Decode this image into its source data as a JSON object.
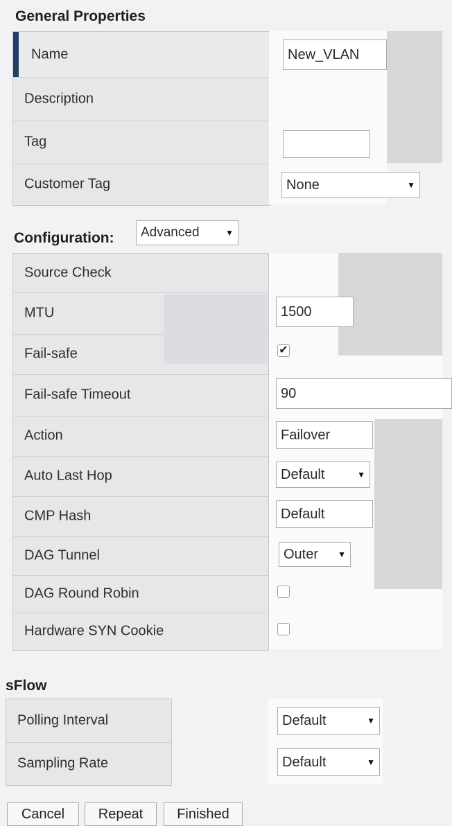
{
  "general": {
    "title": "General Properties",
    "rows": [
      {
        "label": "Name"
      },
      {
        "label": "Description"
      },
      {
        "label": "Tag"
      },
      {
        "label": "Customer Tag"
      }
    ],
    "name_value": "New_VLAN",
    "tag_value": "",
    "customer_tag_value": "None"
  },
  "configuration": {
    "title": "Configuration:",
    "mode_value": "Advanced",
    "rows": [
      {
        "label": "Source Check"
      },
      {
        "label": "MTU"
      },
      {
        "label": "Fail-safe"
      },
      {
        "label": "Fail-safe Timeout"
      },
      {
        "label": "Action"
      },
      {
        "label": "Auto Last Hop"
      },
      {
        "label": "CMP Hash"
      },
      {
        "label": "DAG Tunnel"
      },
      {
        "label": "DAG Round Robin"
      },
      {
        "label": "Hardware SYN Cookie"
      }
    ],
    "mtu_value": "1500",
    "failsafe_checked": true,
    "failsafe_timeout_value": "90",
    "action_value": "Failover",
    "auto_last_hop_value": "Default",
    "cmp_hash_value": "Default",
    "dag_tunnel_value": "Outer",
    "dag_round_robin_checked": false,
    "hardware_syn_cookie_checked": false
  },
  "sflow": {
    "title": "sFlow",
    "rows": [
      {
        "label": "Polling Interval"
      },
      {
        "label": "Sampling Rate"
      }
    ],
    "polling_interval_value": "Default",
    "sampling_rate_value": "Default"
  },
  "buttons": {
    "cancel": "Cancel",
    "repeat": "Repeat",
    "finished": "Finished"
  },
  "icons": {
    "dropdown": "chevron-down-icon",
    "check": "checkmark-icon"
  },
  "colors": {
    "accent": "#1e3f66"
  }
}
